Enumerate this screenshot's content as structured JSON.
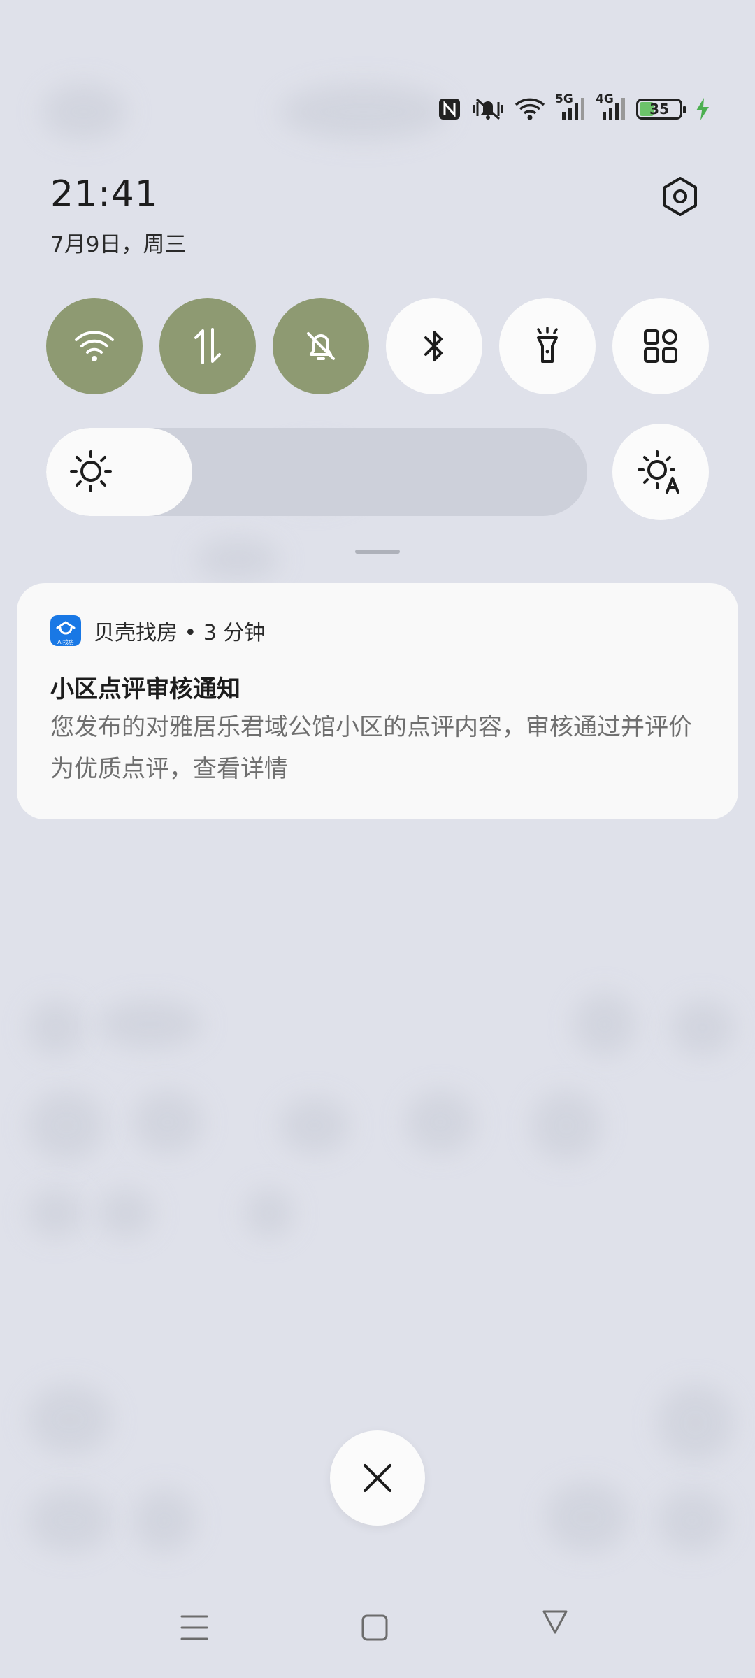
{
  "status_bar": {
    "icons": [
      "nfc-icon",
      "mute-icon",
      "wifi-icon",
      "signal-5g-icon",
      "signal-4g-icon",
      "battery-icon",
      "charging-icon"
    ],
    "net_5g": "5G",
    "net_4g": "4G",
    "battery_level": "35"
  },
  "header": {
    "time": "21:41",
    "date": "7月9日，周三"
  },
  "quick_settings": {
    "toggles": [
      {
        "icon": "wifi-icon",
        "active": true
      },
      {
        "icon": "mobile-data-icon",
        "active": true
      },
      {
        "icon": "do-not-disturb-icon",
        "active": true
      },
      {
        "icon": "bluetooth-icon",
        "active": false
      },
      {
        "icon": "flashlight-icon",
        "active": false
      },
      {
        "icon": "edit-tiles-icon",
        "active": false
      }
    ],
    "brightness_level": 0.27
  },
  "notification": {
    "app_name": "贝壳找房 • 3 分钟",
    "app_icon_label": "AI找房",
    "title": "小区点评审核通知",
    "body": "您发布的对雅居乐君域公馆小区的点评内容，审核通过并评价为优质点评，查看详情"
  },
  "colors": {
    "background": "#dfe1ea",
    "toggle_active": "#8e9a72",
    "toggle_inactive": "#fbfbfb",
    "app_blue": "#1978e5",
    "battery_green": "#6cc36a"
  }
}
